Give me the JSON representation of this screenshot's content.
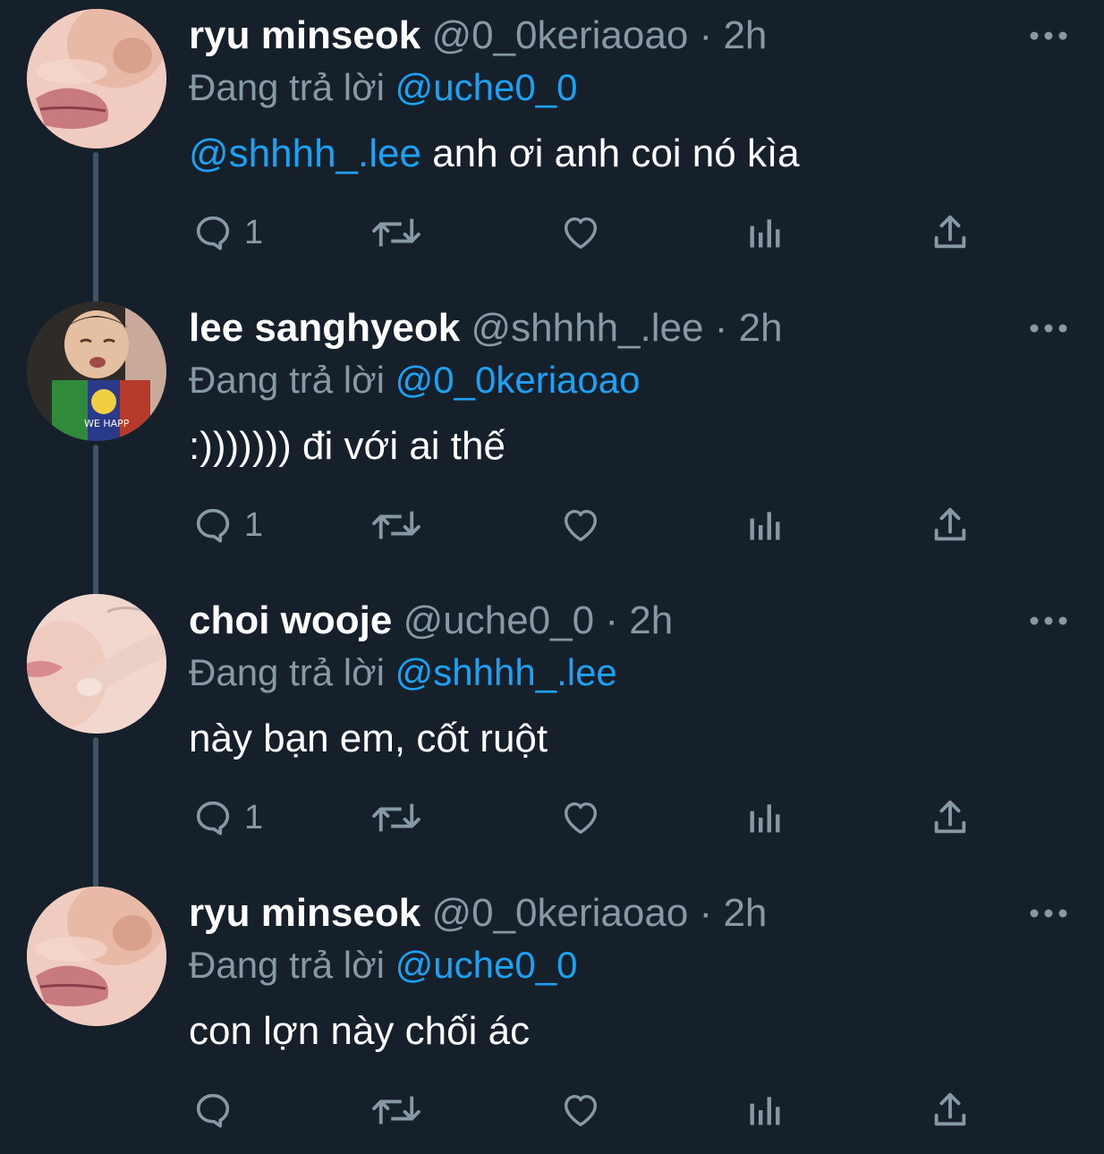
{
  "theme": {
    "background": "#15202b",
    "text": "#ffffff",
    "secondary": "#8899a6",
    "link": "#1da1f2",
    "thread_line": "#3d5466"
  },
  "tweets": [
    {
      "display_name": "ryu minseok",
      "handle": "@0_0keriaoao",
      "separator": "·",
      "time": "2h",
      "replying_prefix": "Đang trả lời",
      "replying_to": "@uche0_0",
      "body_mention": "@shhhh_.lee",
      "body_text": " anh ơi anh coi nó kìa",
      "reply_count": "1",
      "avatar_icon": "avatar-lips-closeup-icon"
    },
    {
      "display_name": "lee sanghyeok",
      "handle": "@shhhh_.lee",
      "separator": "·",
      "time": "2h",
      "replying_prefix": "Đang trả lời",
      "replying_to": "@0_0keriaoao",
      "body_mention": "",
      "body_text": ":))))))) đi với ai thế",
      "reply_count": "1",
      "avatar_icon": "avatar-crying-baby-icon"
    },
    {
      "display_name": "choi wooje",
      "handle": "@uche0_0",
      "separator": "·",
      "time": "2h",
      "replying_prefix": "Đang trả lời",
      "replying_to": "@shhhh_.lee",
      "body_mention": "",
      "body_text": "này bạn em, cốt ruột",
      "reply_count": "1",
      "avatar_icon": "avatar-finger-cheek-icon"
    },
    {
      "display_name": "ryu minseok",
      "handle": "@0_0keriaoao",
      "separator": "·",
      "time": "2h",
      "replying_prefix": "Đang trả lời",
      "replying_to": "@uche0_0",
      "body_mention": "",
      "body_text": "con lợn này chối ác",
      "reply_count": "",
      "avatar_icon": "avatar-lips-closeup-icon"
    }
  ]
}
